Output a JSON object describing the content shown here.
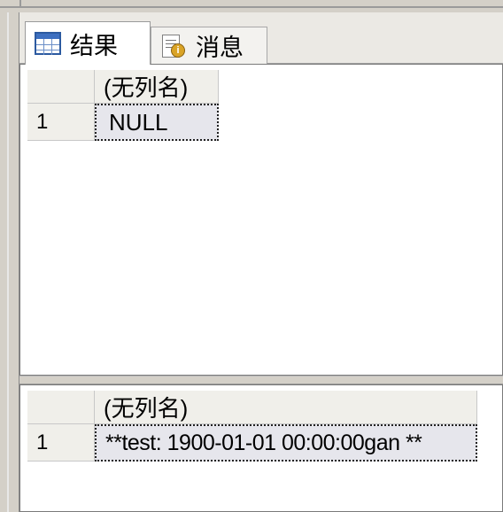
{
  "tabs": {
    "results": {
      "label": "结果",
      "icon": "grid-icon"
    },
    "messages": {
      "label": "消息",
      "icon": "message-icon"
    }
  },
  "result_sets": [
    {
      "column_header": "(无列名)",
      "rows": [
        {
          "number": "1",
          "value": "NULL"
        }
      ]
    },
    {
      "column_header": "(无列名)",
      "rows": [
        {
          "number": "1",
          "value": "**test: 1900-01-01 00:00:00gan **"
        }
      ]
    }
  ],
  "colors": {
    "frame": "#d4d0c8",
    "header_bg": "#f0efea",
    "selected_cell_bg": "#e6e6ec",
    "grid_icon_blue": "#2c5aa0"
  }
}
